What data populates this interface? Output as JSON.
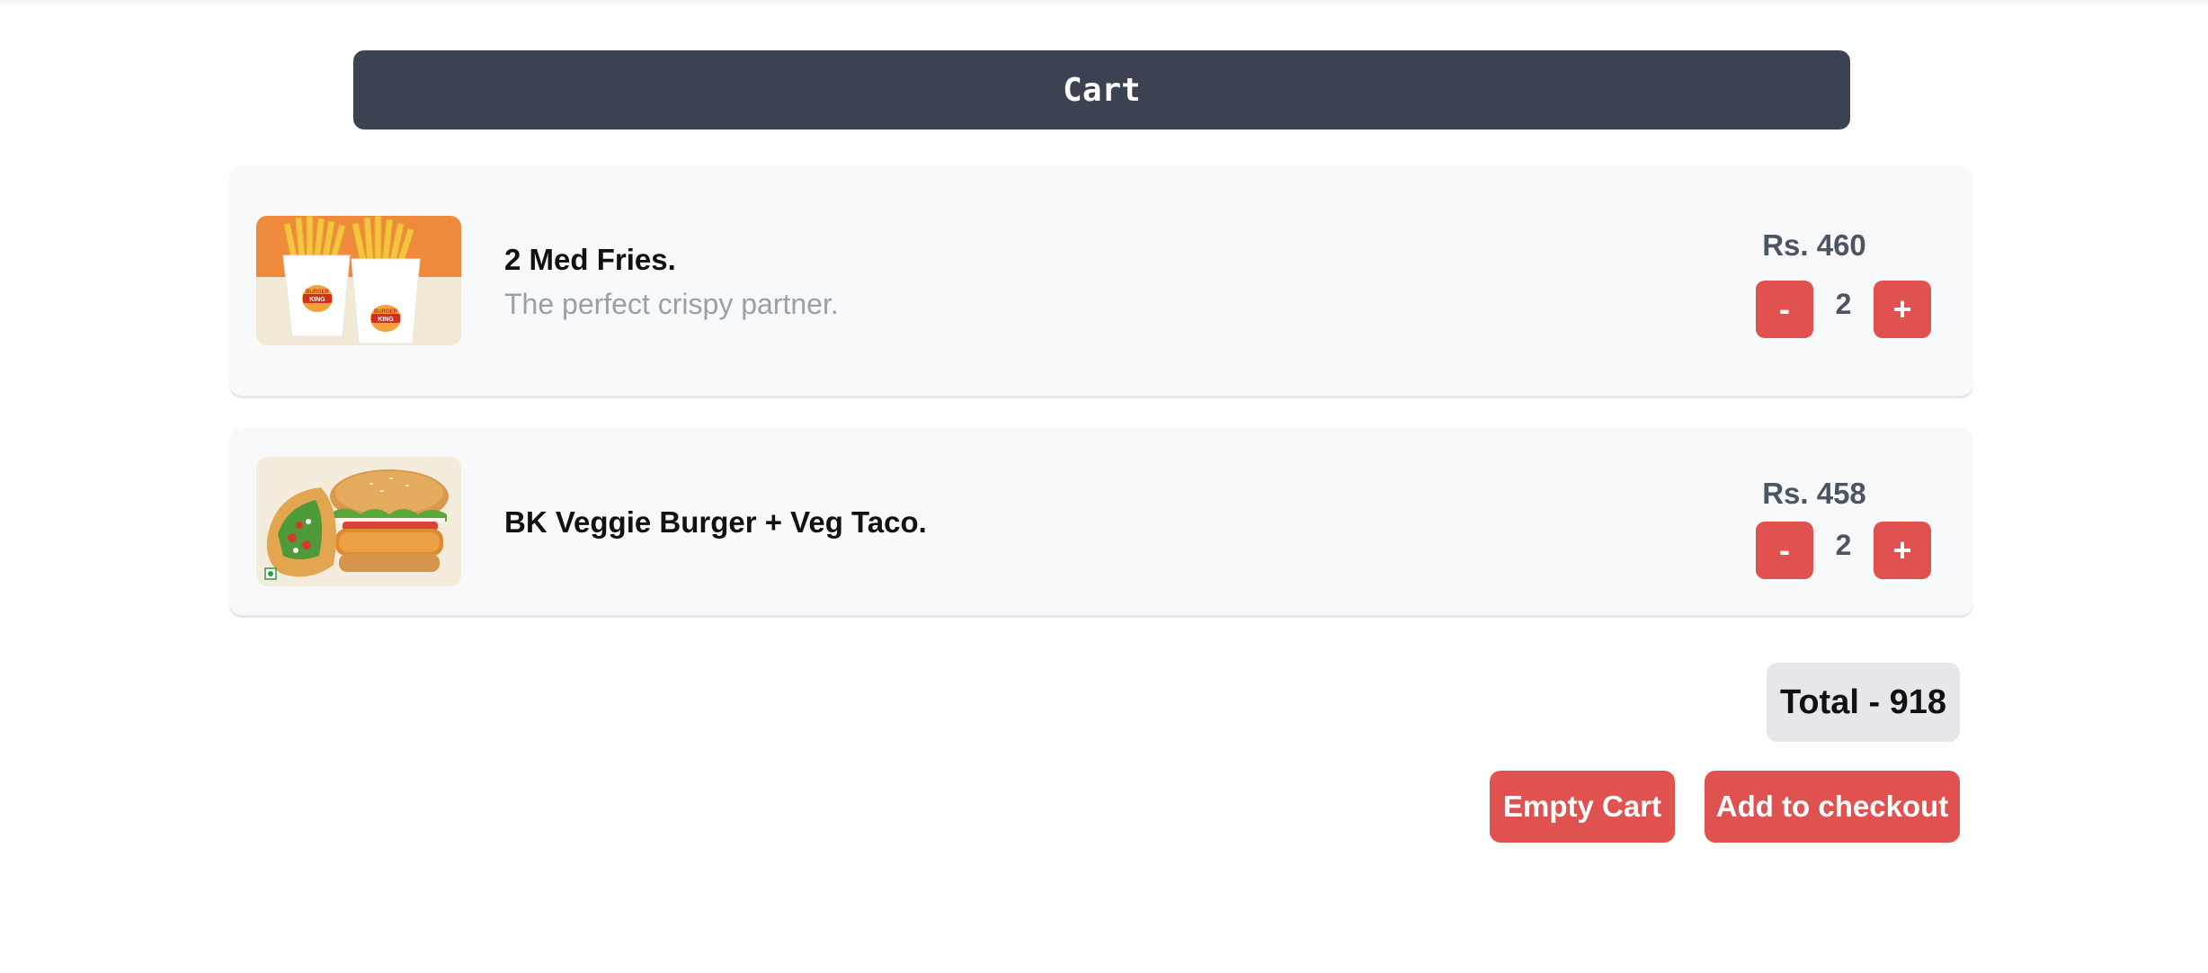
{
  "header": {
    "title": "Cart"
  },
  "colors": {
    "header_bg": "#3b4252",
    "accent_red": "#e0524f",
    "card_bg": "#f8f9fb",
    "total_bg": "#e5e7eb"
  },
  "items": [
    {
      "name": "2 Med Fries.",
      "description": "The perfect crispy partner.",
      "price": "Rs. 460",
      "quantity": "2",
      "minus_label": "-",
      "plus_label": "+",
      "image_icon": "fries-image"
    },
    {
      "name": "BK Veggie Burger + Veg Taco.",
      "description": "",
      "price": "Rs. 458",
      "quantity": "2",
      "minus_label": "-",
      "plus_label": "+",
      "image_icon": "burger-taco-image"
    }
  ],
  "summary": {
    "total_label": "Total - 918"
  },
  "actions": {
    "empty_cart_label": "Empty Cart",
    "checkout_label": "Add to checkout"
  }
}
